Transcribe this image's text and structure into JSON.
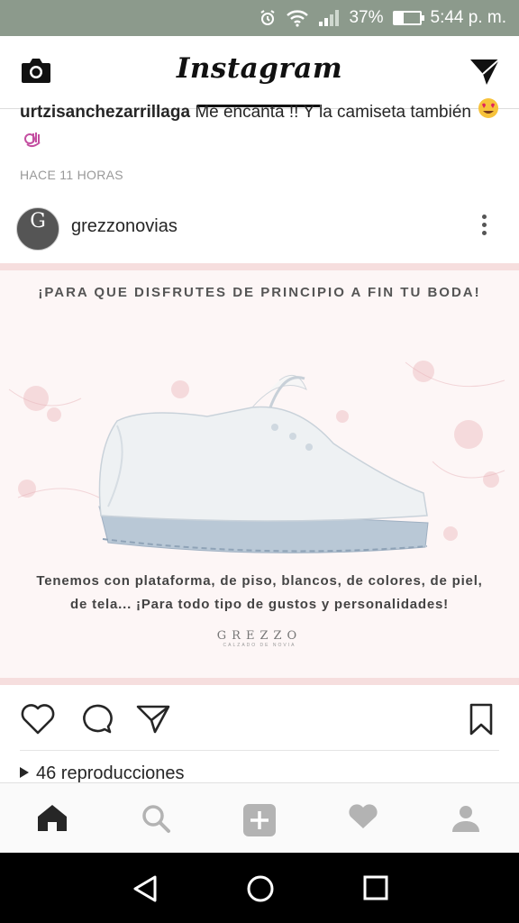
{
  "status_bar": {
    "battery": "37%",
    "time": "5:44 p. m.",
    "battery_level": 0.37
  },
  "app": {
    "title": "Instagram"
  },
  "comment": {
    "username": "urtzisanchezarrillaga",
    "text": "Me encanta !! Y la camiseta también",
    "time": "HACE 11 HORAS"
  },
  "post": {
    "username": "grezzonovias",
    "avatar_letter": "G",
    "image": {
      "headline": "¡PARA QUE DISFRUTES DE PRINCIPIO A FIN TU BODA!",
      "caption_line1": "Tenemos con plataforma, de piso, blancos, de colores, de piel,",
      "caption_line2": "de tela... ¡Para todo tipo de gustos y personalidades!",
      "brand": "GREZZO",
      "brand_tagline": "CALZADO DE NOVIA"
    },
    "views": "46 reproducciones"
  },
  "icons": {
    "camera": "camera-icon",
    "direct": "direct-message-icon",
    "more": "more-options-icon",
    "like": "heart-outline-icon",
    "comment": "comment-icon",
    "share": "share-icon",
    "save": "bookmark-icon",
    "home": "home-icon",
    "search": "search-icon",
    "add": "add-icon",
    "activity": "heart-icon",
    "profile": "profile-icon",
    "back": "back-icon",
    "android_home": "circle-home-icon",
    "recents": "recents-icon"
  },
  "colors": {
    "status_bar": "#8c9a8c",
    "text": "#262626",
    "muted": "#999999",
    "nav_bar": "#000000"
  }
}
